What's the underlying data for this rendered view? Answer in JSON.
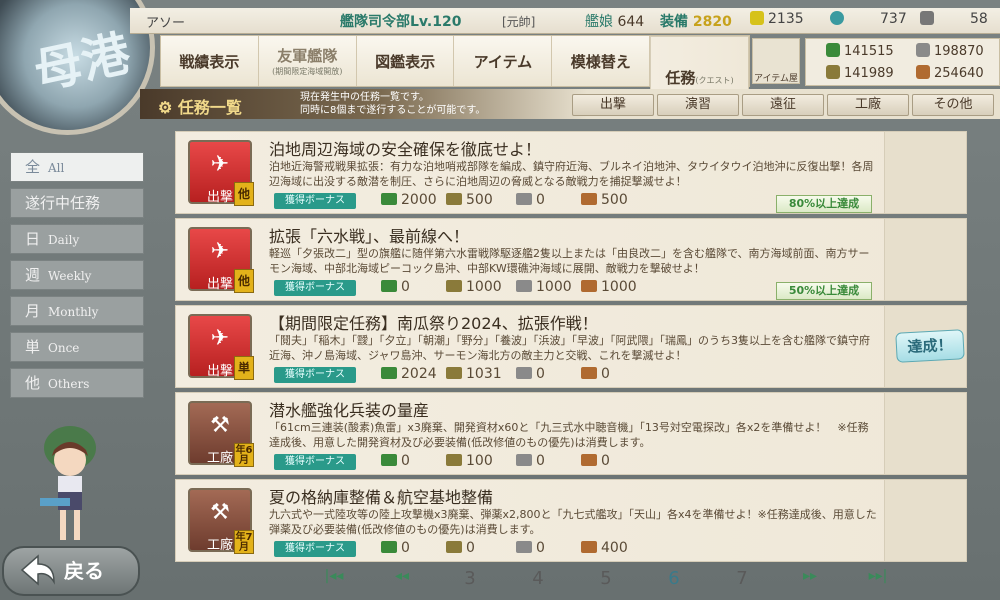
{
  "header": {
    "admiral_name": "アソー",
    "hq_level_label": "艦隊司令部Lv.",
    "hq_level": "120",
    "rank": "[元帥]",
    "ship_label": "艦娘",
    "ship_count": "644",
    "equip_label": "装備",
    "equip_count": "2820",
    "bucket": "2135",
    "dev_material": "737",
    "screws": "58"
  },
  "nav": {
    "items": [
      {
        "label": "戦績表示"
      },
      {
        "label": "友軍艦隊",
        "sub": "(期間限定海域開放)"
      },
      {
        "label": "図鑑表示"
      },
      {
        "label": "アイテム"
      },
      {
        "label": "模様替え"
      },
      {
        "label": "任務",
        "sub": "(クエスト)"
      }
    ],
    "shop": "アイテム屋"
  },
  "stocks": {
    "fuel": "141515",
    "steel": "198870",
    "ammo": "141989",
    "bauxite": "254640"
  },
  "quest_header": {
    "title": "任務一覧",
    "desc_line1": "現在発生中の任務一覧です。",
    "desc_line2": "同時に8個まで遂行することが可能です。"
  },
  "filter_tabs": [
    "出撃",
    "演習",
    "遠征",
    "工廠",
    "その他"
  ],
  "sidebar": [
    {
      "kanji": "全",
      "en": "All"
    },
    {
      "kanji": "遂行中任務",
      "en": ""
    },
    {
      "kanji": "日",
      "en": "Daily"
    },
    {
      "kanji": "週",
      "en": "Weekly"
    },
    {
      "kanji": "月",
      "en": "Monthly"
    },
    {
      "kanji": "単",
      "en": "Once"
    },
    {
      "kanji": "他",
      "en": "Others"
    }
  ],
  "bonus_label": "獲得ボーナス",
  "quests": [
    {
      "category": "出撃",
      "tag": "他",
      "title": "泊地周辺海域の安全確保を徹底せよ！",
      "desc": "泊地近海警戒戦果拡張：有力な泊地哨戒部隊を編成、鎮守府近海、ブルネイ泊地沖、タウイタウイ泊地沖に反復出撃！各周辺海域に出没する敵潜を制圧、さらに泊地周辺の脅威となる敵戦力を捕捉撃滅せよ！",
      "fuel": "2000",
      "ammo": "500",
      "steel": "0",
      "baux": "500",
      "progress": "80%以上達成"
    },
    {
      "category": "出撃",
      "tag": "他",
      "title": "拡張「六水戦」、最前線へ！",
      "desc": "軽巡「夕張改二」型の旗艦に随伴第六水雷戦隊駆逐艦2隻以上または「由良改二」を含む艦隊で、南方海域前面、南方サーモン海域、中部北海域ピーコック島沖、中部KW環礁沖海域に展開、敵戦力を撃破せよ！",
      "fuel": "0",
      "ammo": "1000",
      "steel": "1000",
      "baux": "1000",
      "progress": "50%以上達成"
    },
    {
      "category": "出撃",
      "tag": "単",
      "title": "【期間限定任務】南瓜祭り2024、拡張作戦！",
      "desc": "「鬩夫」「稲木」「靉」「夕立」「朝潮」「野分」「養波」「浜波」「早波」「阿武隈」「瑞鳳」のうち3隻以上を含む艦隊で鎮守府近海、沖ノ島海域、ジャワ島沖、サーモン海北方の敵主力と交戦、これを撃滅せよ！",
      "fuel": "2024",
      "ammo": "1031",
      "steel": "0",
      "baux": "0",
      "done": "達成！"
    },
    {
      "category": "工廠",
      "tag": "年6月",
      "title": "潜水艦強化兵装の量産",
      "desc": "「61cm三連装(酸素)魚雷」x3廃棄、開発資材x60と「九三式水中聴音機」「13号対空電探改」各x2を準備せよ！　※任務達成後、用意した開発資材及び必要装備(低改修値のもの優先)は消費します。",
      "fuel": "0",
      "ammo": "100",
      "steel": "0",
      "baux": "0"
    },
    {
      "category": "工廠",
      "tag": "年7月",
      "title": "夏の格納庫整備＆航空基地整備",
      "desc": "九六式や一式陸攻等の陸上攻撃機x3廃棄、弾薬x2,800と「九七式艦攻」「天山」各x4を準備せよ！※任務達成後、用意した弾薬及び必要装備(低改修値のもの優先)は消費します。",
      "fuel": "0",
      "ammo": "0",
      "steel": "0",
      "baux": "400"
    }
  ],
  "pager": {
    "pages": [
      "3",
      "4",
      "5",
      "6",
      "7"
    ],
    "current": "6"
  },
  "back_label": "戻る",
  "circle_label": "母港"
}
